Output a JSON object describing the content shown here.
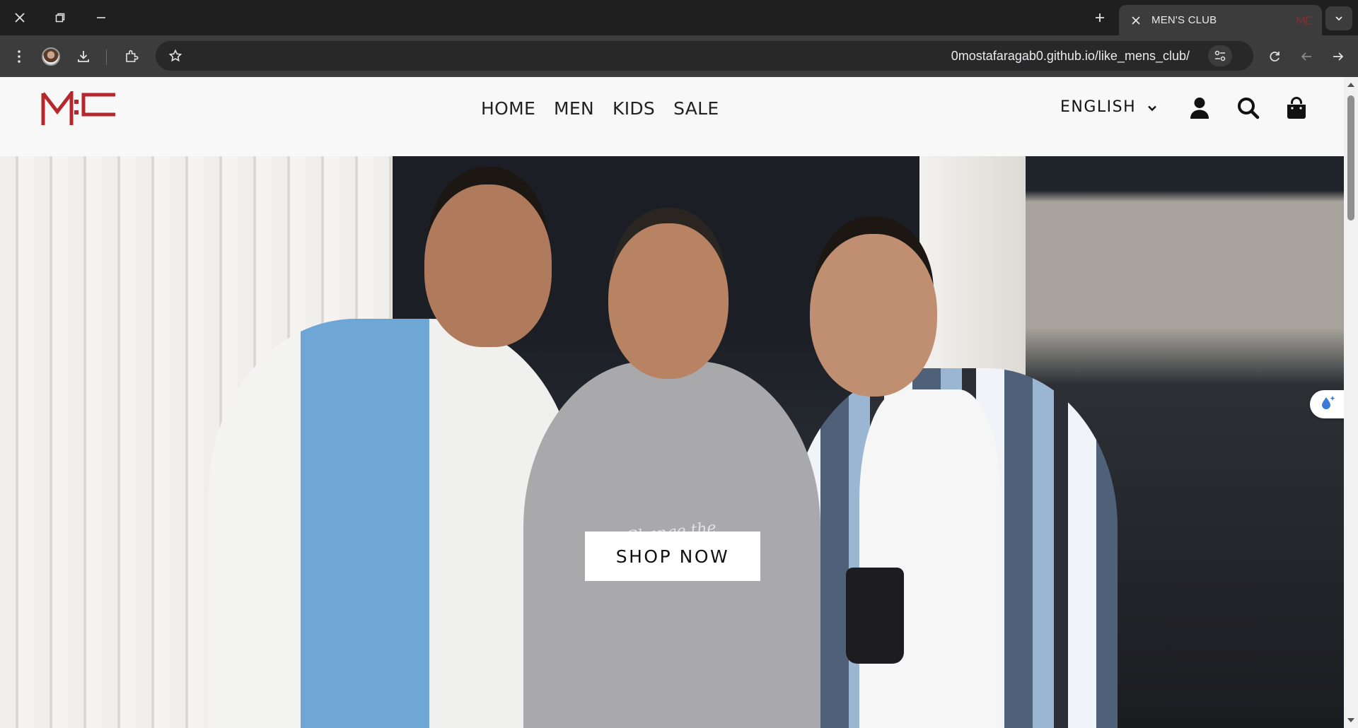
{
  "browser": {
    "tab_title": "MEN'S CLUB",
    "url": "0mostafaragab0.github.io/like_mens_club/"
  },
  "site": {
    "logo_text": "MC",
    "brand_color": "#b4282d",
    "nav": [
      {
        "label": "HOME"
      },
      {
        "label": "MEN"
      },
      {
        "label": "KIDS"
      },
      {
        "label": "SALE"
      }
    ],
    "language": "ENGLISH",
    "icons": [
      "user-icon",
      "search-icon",
      "shopping-bag-icon"
    ]
  },
  "hero": {
    "cta_label": "SHOP NOW",
    "hoodie_print": "Change the world"
  }
}
